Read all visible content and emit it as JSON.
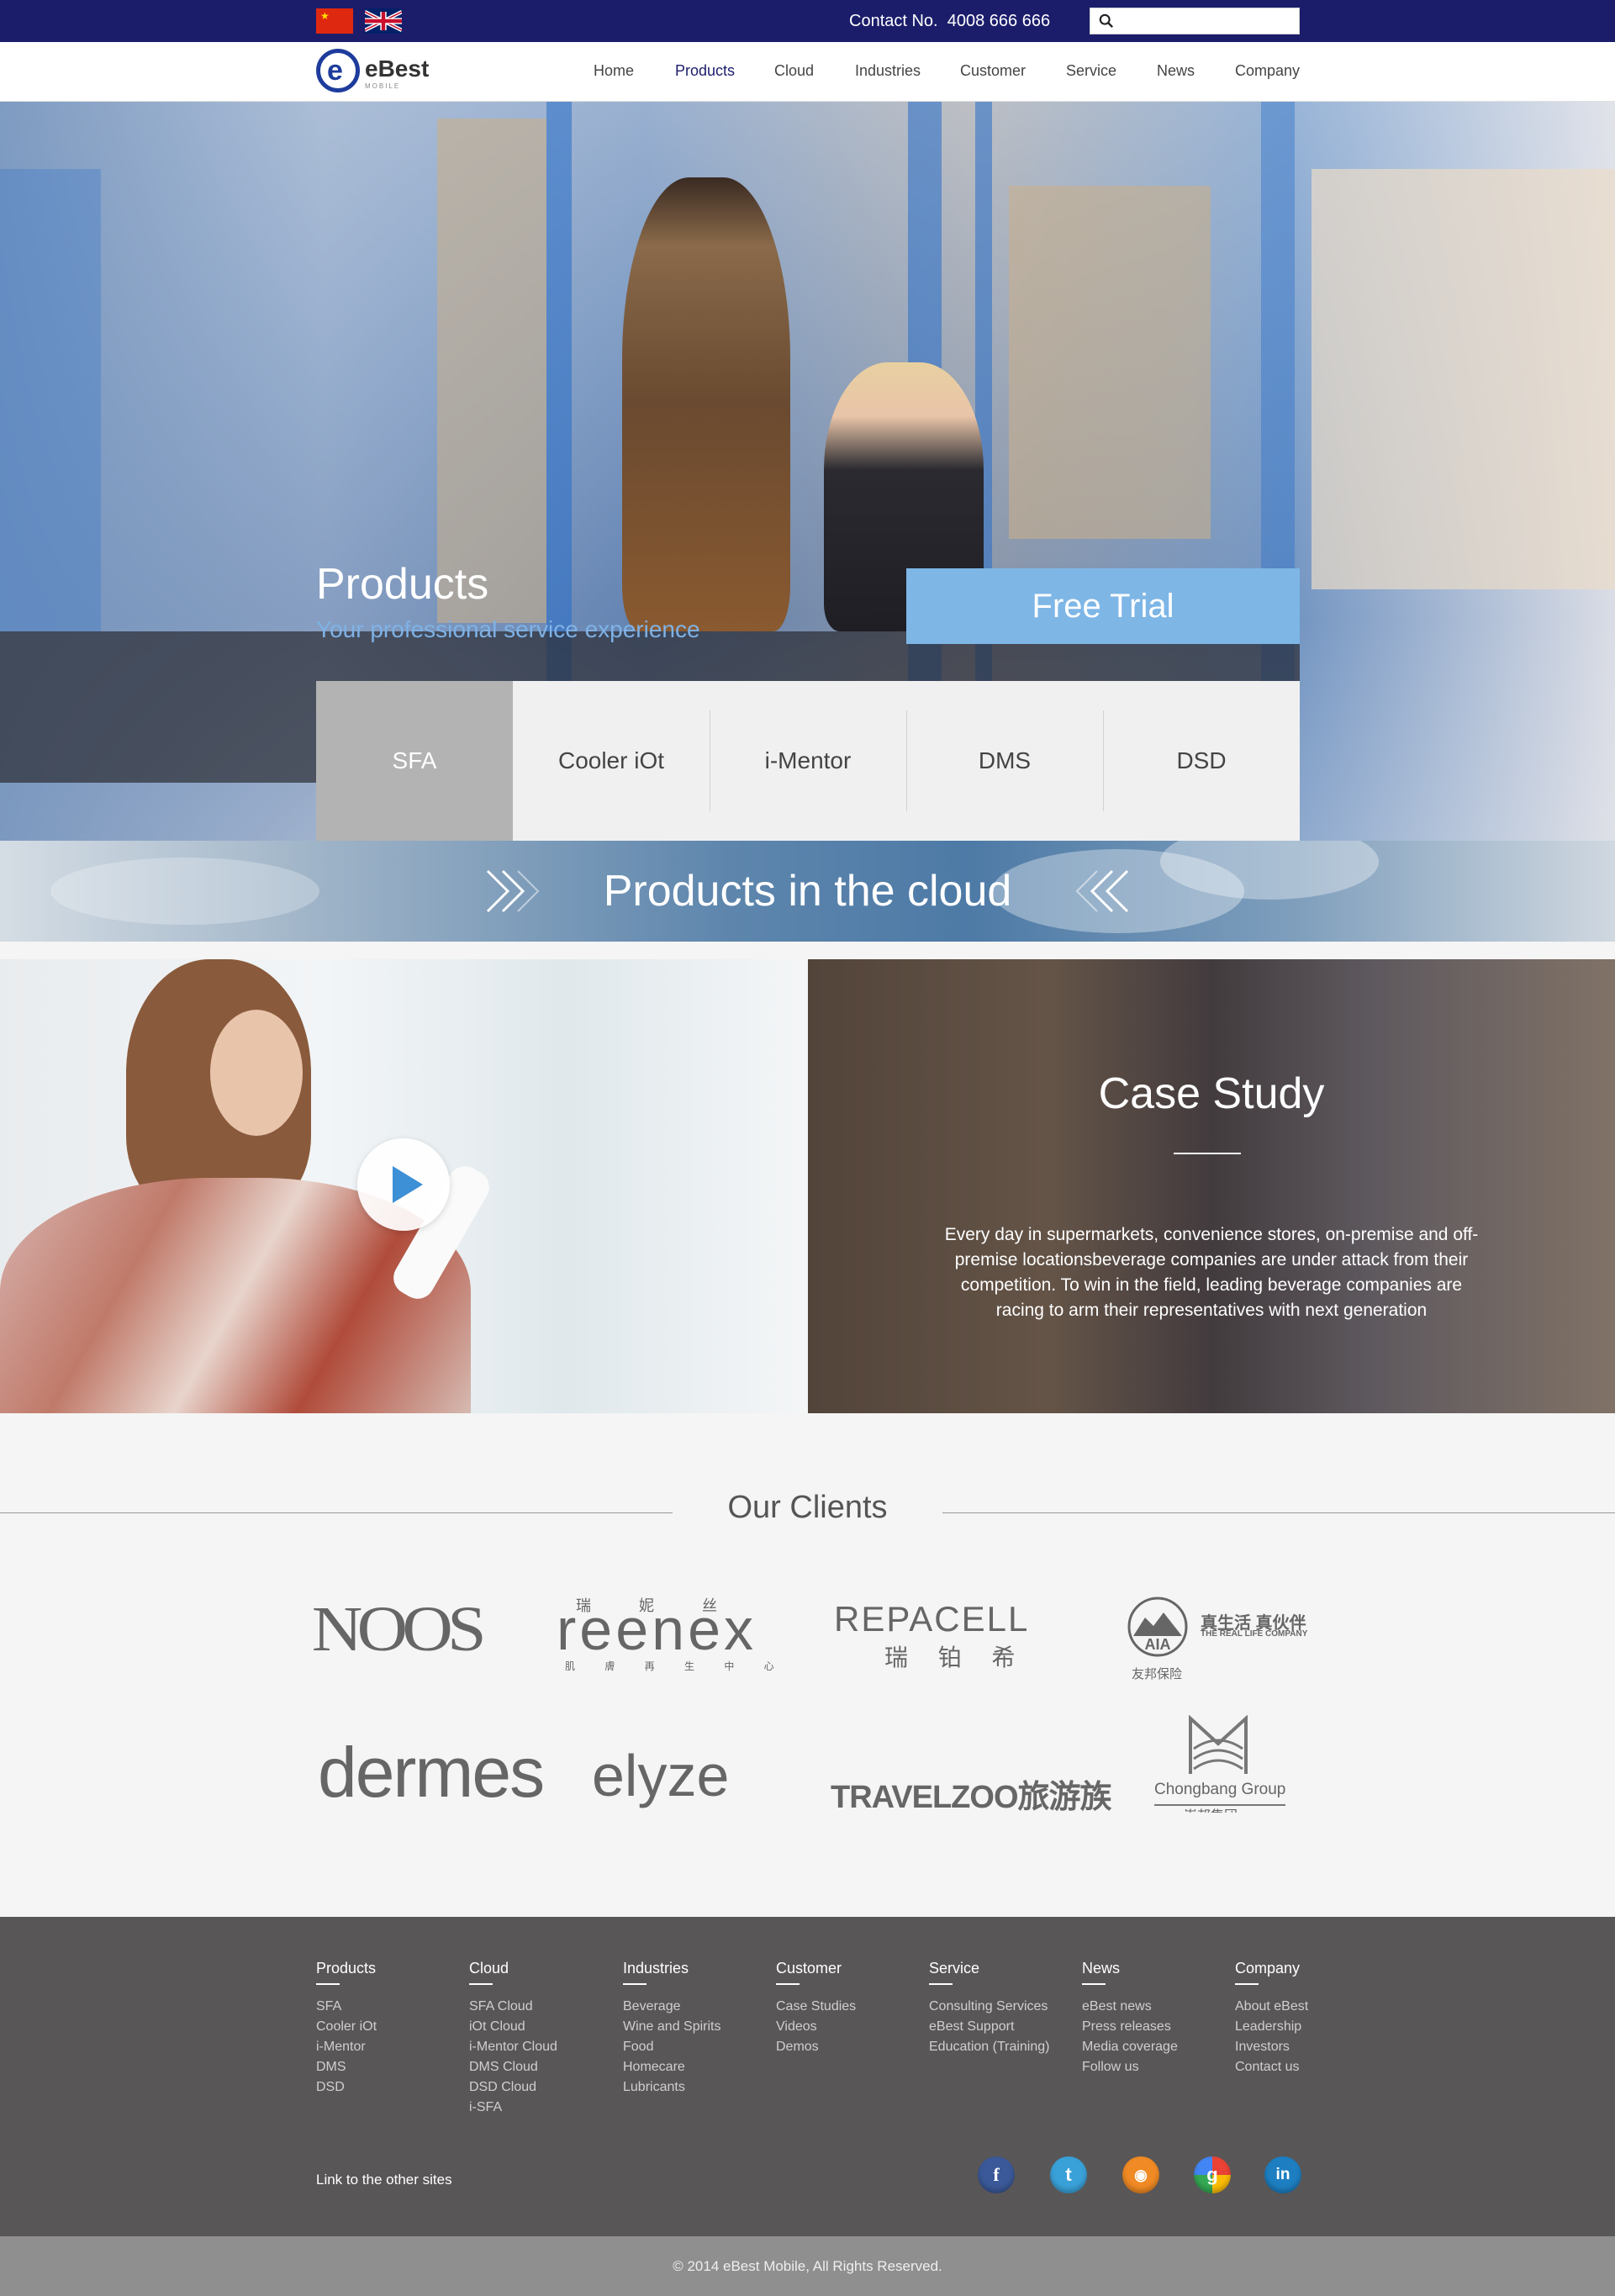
{
  "topbar": {
    "flags": [
      "china-flag",
      "uk-flag"
    ],
    "contact_label": "Contact No.",
    "contact_number": "4008 666 666",
    "search_placeholder": "",
    "color": "#1b1d6b"
  },
  "header": {
    "logo_text": "eBest",
    "logo_sub": "MOBILE",
    "nav": [
      {
        "label": "Home"
      },
      {
        "label": "Products",
        "active": true
      },
      {
        "label": "Cloud"
      },
      {
        "label": "Industries"
      },
      {
        "label": "Customer"
      },
      {
        "label": "Service"
      },
      {
        "label": "News"
      },
      {
        "label": "Company"
      }
    ]
  },
  "hero": {
    "title": "Products",
    "subtitle": "Your professional service experience",
    "cta": "Free Trial",
    "tabs": [
      "SFA",
      "Cooler iOt",
      "i-Mentor",
      "DMS",
      "DSD"
    ],
    "active_tab": "SFA",
    "accent": "#7eb6e6"
  },
  "cloud_banner": {
    "title": "Products in the cloud"
  },
  "case_study": {
    "title": "Case Study",
    "text": "Every day in supermarkets, convenience stores, on-premise and off-premise locationsbeverage companies are under attack from their competition. To win in the field, leading beverage companies are racing to arm their representatives with next generation"
  },
  "clients": {
    "title": "Our Clients",
    "logos": [
      {
        "name": "NOOS"
      },
      {
        "name": "reenex",
        "top": "瑞  妮  丝",
        "bottom": "肌 膚 再 生 中 心"
      },
      {
        "name": "REPACELL",
        "bottom": "瑞 铂 希"
      },
      {
        "name": "AIA",
        "sub": "真生活 真伙伴",
        "small": "THE REAL LIFE COMPANY",
        "cn": "友邦保险"
      },
      {
        "name": "dermes"
      },
      {
        "name": "elyze"
      },
      {
        "name": "TRAVELZOO",
        "cn": "旅游族"
      },
      {
        "name": "Chongbang Group",
        "cn": "崇邦集团"
      }
    ]
  },
  "footer": {
    "columns": [
      {
        "heading": "Products",
        "links": [
          "SFA",
          "Cooler iOt",
          "i-Mentor",
          "DMS",
          "DSD"
        ]
      },
      {
        "heading": "Cloud",
        "links": [
          "SFA Cloud",
          "iOt Cloud",
          "i-Mentor Cloud",
          "DMS Cloud",
          "DSD Cloud",
          "i-SFA"
        ]
      },
      {
        "heading": "Industries",
        "links": [
          "Beverage",
          "Wine and Spirits",
          "Food",
          "Homecare",
          "Lubricants"
        ]
      },
      {
        "heading": "Customer",
        "links": [
          "Case Studies",
          "Videos",
          "Demos"
        ]
      },
      {
        "heading": "Service",
        "links": [
          "Consulting Services",
          "eBest  Support",
          "Education (Training)"
        ]
      },
      {
        "heading": "News",
        "links": [
          "eBest news",
          "Press releases",
          "Media coverage",
          "Follow us"
        ]
      },
      {
        "heading": "Company",
        "links": [
          "About eBest",
          "Leadership",
          "Investors",
          "Contact us"
        ]
      }
    ],
    "other_sites": "Link to the other sites",
    "social": [
      {
        "icon": "facebook-icon",
        "glyph": "f",
        "color": "#3b5998"
      },
      {
        "icon": "twitter-icon",
        "glyph": "t",
        "color": "#3aa1d8"
      },
      {
        "icon": "rss-icon",
        "glyph": "◉",
        "color": "#f08a24"
      },
      {
        "icon": "google-icon",
        "glyph": "g",
        "color": "#34a853"
      },
      {
        "icon": "linkedin-icon",
        "glyph": "in",
        "color": "#1d7fc2"
      }
    ],
    "copyright": "© 2014 eBest Mobile, All Rights Reserved."
  }
}
